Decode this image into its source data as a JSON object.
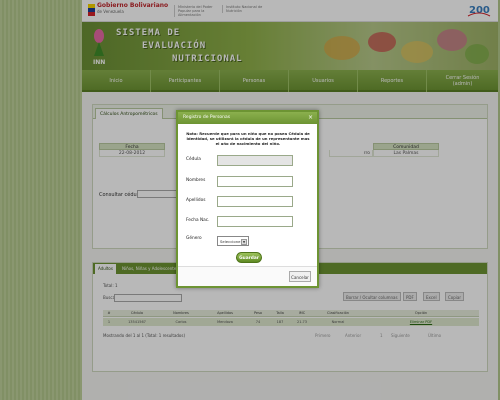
{
  "gov_bar": {
    "title_line1": "Gobierno Bolivariano",
    "title_line2": "de Venezuela",
    "ministry": "Ministerio del Poder Popular para la Alimentación",
    "institute": "Instituto Nacional de Nutrición"
  },
  "banner": {
    "title_line1": "SISTEMA DE",
    "title_line2": "EVALUACIÓN",
    "title_line3": "NUTRICIONAL",
    "logo_text": "INN"
  },
  "nav": {
    "items": [
      {
        "label": "Inicio"
      },
      {
        "label": "Participantes"
      },
      {
        "label": "Personas"
      },
      {
        "label": "Usuarios"
      },
      {
        "label": "Reportes"
      },
      {
        "label": "Cerrar Sesión\n(admin)"
      }
    ]
  },
  "top_section": {
    "tab_label": "Cálculos Antropométricos",
    "table_headers": [
      "Fecha",
      "Comunidad"
    ],
    "row": {
      "fecha": "22-08-2012",
      "partial": "rro",
      "comunidad": "Las Palmas"
    },
    "consult_label": "Consultar cédula:"
  },
  "bottom_section": {
    "tabs": [
      "Adultos",
      "Niños, Niñas y Adolescente"
    ],
    "total_label": "Total: 1",
    "search_label": "Buscar:",
    "export_buttons": [
      "Borrar / Ocultar columnas",
      "PDF",
      "Excel",
      "Copiar"
    ],
    "columns": [
      "#",
      "Cédula",
      "Nombres",
      "Apellidos",
      "Peso",
      "Talla",
      "IMC",
      "Clasificación",
      "Opción"
    ],
    "rows": [
      {
        "num": "1",
        "cedula": "13541567",
        "nombres": "Carlos",
        "apellidos": "Mendoza",
        "peso": "74",
        "talla": "187",
        "imc": "21.73",
        "clasificacion": "Normal",
        "opcion": "Eliminar PDF"
      }
    ],
    "footer_text": "Mostrando del 1 al 1 (Total: 1 resultados)",
    "pager": [
      "Primero",
      "Anterior",
      "1",
      "Siguiente",
      "Último"
    ]
  },
  "modal": {
    "title": "Registro de Personas",
    "note": "Nota: Recuerde que para un niño que no posea Cédula de Identidad, se utilizará la cédula de un representante mas el año de nacimiento del niño.",
    "fields": [
      {
        "label": "Cédula",
        "value": ""
      },
      {
        "label": "Nombres",
        "value": ""
      },
      {
        "label": "Apellidos",
        "value": ""
      },
      {
        "label": "Fecha Nac.",
        "value": ""
      }
    ],
    "genero_label": "Género",
    "genero_selected": "Seleccione",
    "save_label": "Guardar",
    "cancel_label": "Cancelar"
  }
}
